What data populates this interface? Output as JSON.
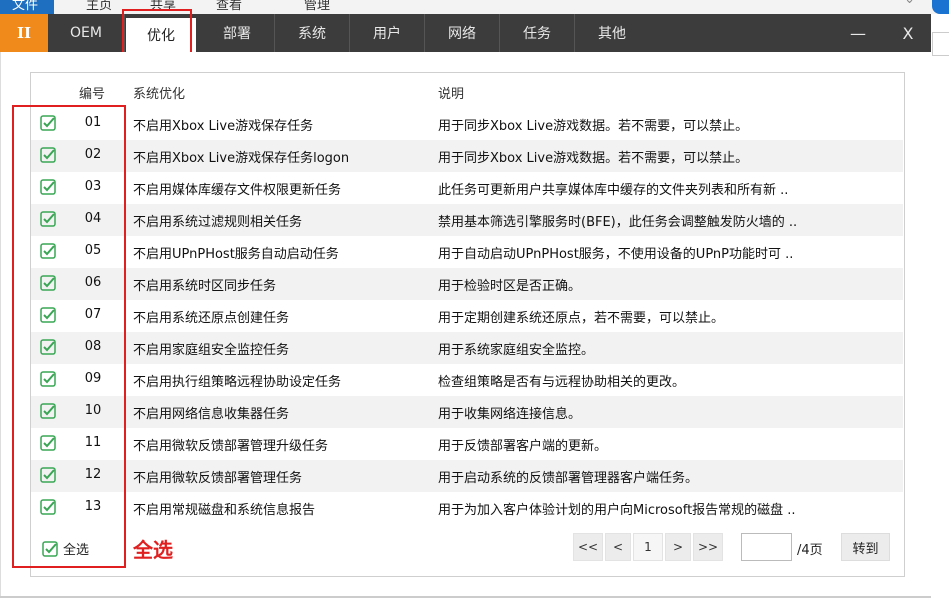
{
  "host_menu": {
    "items": [
      "文件",
      "主页",
      "共享",
      "查看",
      "管理"
    ]
  },
  "app": {
    "logo": "II",
    "tabs": [
      "OEM",
      "优化",
      "部署",
      "系统",
      "用户",
      "网络",
      "任务",
      "其他"
    ],
    "active_tab": "优化",
    "minimize": "—",
    "close": "X"
  },
  "table": {
    "headers": {
      "num": "编号",
      "name": "系统优化",
      "desc": "说明"
    },
    "rows": [
      {
        "num": "01",
        "name": "不启用Xbox Live游戏保存任务",
        "desc": "用于同步Xbox Live游戏数据。若不需要，可以禁止。",
        "checked": true
      },
      {
        "num": "02",
        "name": "不启用Xbox Live游戏保存任务logon",
        "desc": "用于同步Xbox Live游戏数据。若不需要，可以禁止。",
        "checked": true
      },
      {
        "num": "03",
        "name": "不启用媒体库缓存文件权限更新任务",
        "desc": "此任务可更新用户共享媒体库中缓存的文件夹列表和所有新 ..",
        "checked": true
      },
      {
        "num": "04",
        "name": "不启用系统过滤规则相关任务",
        "desc": "禁用基本筛选引擎服务时(BFE)，此任务会调整触发防火墙的 ..",
        "checked": true
      },
      {
        "num": "05",
        "name": "不启用UPnPHost服务自动启动任务",
        "desc": "用于自动启动UPnPHost服务，不使用设备的UPnP功能时可 ..",
        "checked": true
      },
      {
        "num": "06",
        "name": "不启用系统时区同步任务",
        "desc": "用于检验时区是否正确。",
        "checked": true
      },
      {
        "num": "07",
        "name": "不启用系统还原点创建任务",
        "desc": "用于定期创建系统还原点，若不需要，可以禁止。",
        "checked": true
      },
      {
        "num": "08",
        "name": "不启用家庭组安全监控任务",
        "desc": "用于系统家庭组安全监控。",
        "checked": true
      },
      {
        "num": "09",
        "name": "不启用执行组策略远程协助设定任务",
        "desc": "检查组策略是否有与远程协助相关的更改。",
        "checked": true
      },
      {
        "num": "10",
        "name": "不启用网络信息收集器任务",
        "desc": "用于收集网络连接信息。",
        "checked": true
      },
      {
        "num": "11",
        "name": "不启用微软反馈部署管理升级任务",
        "desc": "用于反馈部署客户端的更新。",
        "checked": true
      },
      {
        "num": "12",
        "name": "不启用微软反馈部署管理任务",
        "desc": "用于启动系统的反馈部署管理器客户端任务。",
        "checked": true
      },
      {
        "num": "13",
        "name": "不启用常规磁盘和系统信息报告",
        "desc": "用于为加入客户体验计划的用户向Microsoft报告常规的磁盘 ..",
        "checked": true
      }
    ]
  },
  "footer": {
    "select_all_label": "全选",
    "select_all_annotation": "全选",
    "first": "<<",
    "prev": "<",
    "page": "1",
    "next": ">",
    "last": ">>",
    "page_input": "",
    "total": "/4页",
    "go": "转到"
  },
  "colors": {
    "accent_orange": "#f08a1b",
    "titlebar": "#3c3c3c",
    "check_green": "#3aa655",
    "annotation_red": "#e02020"
  }
}
